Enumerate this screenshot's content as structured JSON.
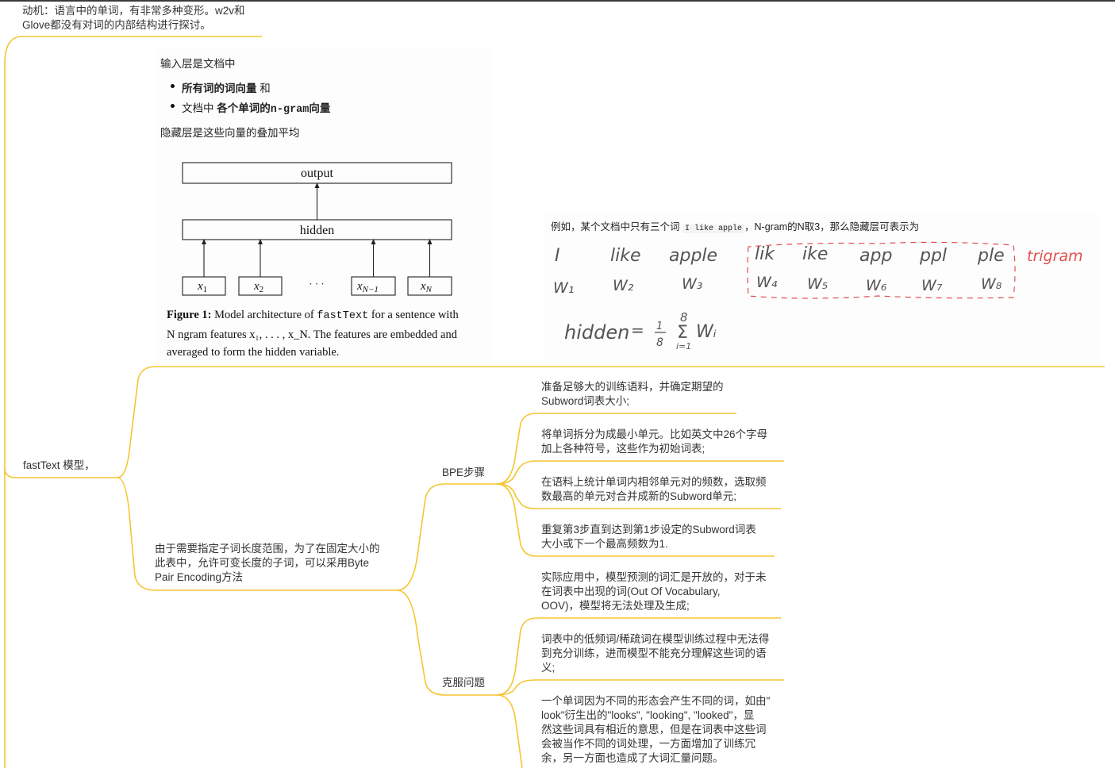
{
  "accent_color": "#f5c531",
  "top_note": [
    "动机：语言中的单词，有非常多种变形。w2v和",
    "Glove都没有对词的内部结构进行探讨。"
  ],
  "root_label": "fastText 模型，",
  "arch_card": {
    "intro": "输入层是文档中",
    "bullet1_bold": "所有词的词向量",
    "bullet1_tail": "和",
    "bullet2_head": "文档中",
    "bullet2_bold": "各个单词的",
    "bullet2_code": "n-gram",
    "bullet2_bold2": "向量",
    "hidden_note": "隐藏层是这些向量的叠加平均",
    "output_label": "output",
    "hidden_label": "hidden",
    "inputs": [
      "x",
      "x",
      "x",
      "x"
    ],
    "input_subs": [
      "1",
      "2",
      "N−1",
      "N"
    ],
    "dots": "· · ·",
    "figure_label": "Figure 1:",
    "caption_a": "Model architecture of",
    "caption_code": "fastText",
    "caption_b": "for a sentence with",
    "caption_line2": "N ngram features x₁, . . . , x_N. The features are embedded and",
    "caption_line3": "averaged to form the hidden variable."
  },
  "example_card": {
    "text_a": "例如，某个文档中只有三个词",
    "code": "I like apple",
    "text_b": "，N-gram的N取3，那么隐藏层可表示为",
    "words": [
      "I",
      "like",
      "apple",
      "lik",
      "ike",
      "app",
      "ppl",
      "ple"
    ],
    "weights": [
      "W₁",
      "W₂",
      "W₃",
      "W₄",
      "W₅",
      "W₆",
      "W₇",
      "W₈"
    ],
    "trigram": "trigram",
    "formula_lhs": "hidden",
    "formula_eq": "=",
    "formula_frac_num": "1",
    "formula_frac_den": "8",
    "formula_sum_top": "8",
    "formula_sum_sym": "Σ",
    "formula_sum_bottom": "i=1",
    "formula_term": "Wᵢ"
  },
  "bpe_parent": [
    "由于需要指定子词长度范围，为了在固定大小的",
    "此表中，允许可变长度的子词，可以采用Byte",
    "Pair Encoding方法"
  ],
  "bpe_steps_label": "BPE步骤",
  "bpe_steps": [
    [
      "准备足够大的训练语料，并确定期望的",
      "Subword词表大小;"
    ],
    [
      "将单词拆分为成最小单元。比如英文中26个字母",
      "加上各种符号，这些作为初始词表;"
    ],
    [
      "在语料上统计单词内相邻单元对的频数，选取频",
      "数最高的单元对合并成新的Subword单元;"
    ],
    [
      "重复第3步直到达到第1步设定的Subword词表",
      "大小或下一个最高频数为1."
    ]
  ],
  "problems_label": "克服问题",
  "problems": [
    [
      "实际应用中，模型预测的词汇是开放的，对于未",
      "在词表中出现的词(Out Of Vocabulary,",
      "OOV)，模型将无法处理及生成;"
    ],
    [
      "词表中的低频词/稀疏词在模型训练过程中无法得",
      "到充分训练，进而模型不能充分理解这些词的语",
      "义;"
    ],
    [
      "一个单词因为不同的形态会产生不同的词，如由\"",
      "look\"衍生出的\"looks\", \"looking\", \"looked\"，显",
      "然这些词具有相近的意思，但是在词表中这些词",
      "会被当作不同的词处理，一方面增加了训练冗",
      "余，另一方面也造成了大词汇量问题。"
    ]
  ]
}
